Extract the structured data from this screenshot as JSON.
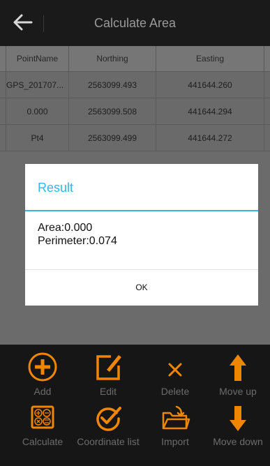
{
  "header": {
    "title": "Calculate Area",
    "back_icon": "arrow-left-icon"
  },
  "table": {
    "columns": [
      "PointName",
      "Northing",
      "Easting"
    ],
    "rows": [
      {
        "name": "GPS_201707...",
        "northing": "2563099.493",
        "easting": "441644.260"
      },
      {
        "name": "0.000",
        "northing": "2563099.508",
        "easting": "441644.294"
      },
      {
        "name": "Pt4",
        "northing": "2563099.499",
        "easting": "441644.272"
      }
    ]
  },
  "dialog": {
    "title": "Result",
    "area": "Area:0.000",
    "perimeter": "Perimeter:0.074",
    "ok": "OK"
  },
  "toolbar": {
    "accent": "#f08600",
    "items": [
      {
        "label": "Add",
        "icon": "plus-circle-icon"
      },
      {
        "label": "Edit",
        "icon": "edit-icon"
      },
      {
        "label": "Delete",
        "icon": "close-icon"
      },
      {
        "label": "Move up",
        "icon": "arrow-up-icon"
      },
      {
        "label": "Calculate",
        "icon": "calculator-icon"
      },
      {
        "label": "Coordinate list",
        "icon": "checkmark-icon"
      },
      {
        "label": "Import",
        "icon": "import-folder-icon"
      },
      {
        "label": "Move down",
        "icon": "arrow-down-icon"
      }
    ]
  }
}
